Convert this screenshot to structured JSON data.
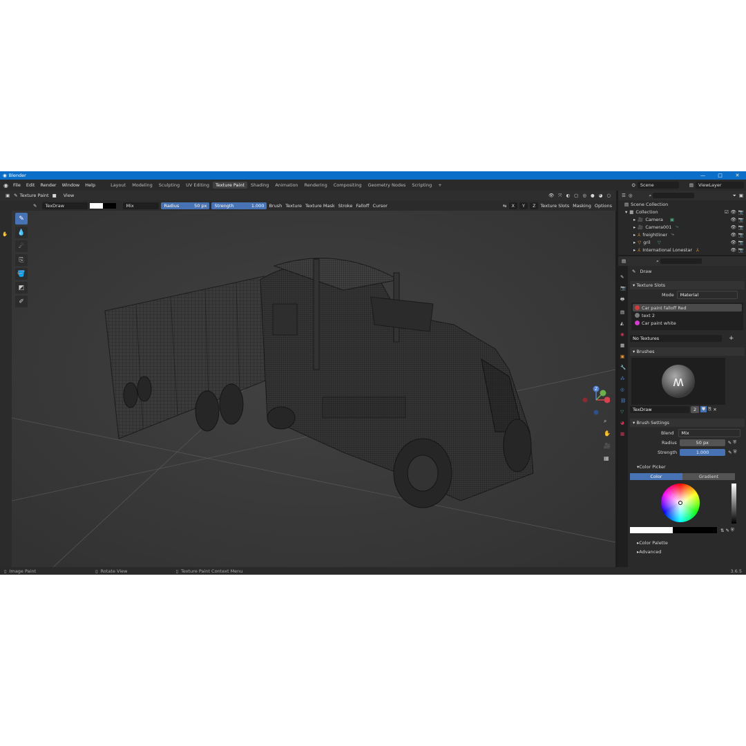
{
  "app": {
    "title": "Blender",
    "version": "3.6.5"
  },
  "window_controls": {
    "minimize": "—",
    "maximize": "□",
    "close": "✕"
  },
  "menu": [
    "File",
    "Edit",
    "Render",
    "Window",
    "Help"
  ],
  "workspaces": [
    {
      "label": "Layout"
    },
    {
      "label": "Modeling"
    },
    {
      "label": "Sculpting"
    },
    {
      "label": "UV Editing"
    },
    {
      "label": "Texture Paint",
      "active": true
    },
    {
      "label": "Shading"
    },
    {
      "label": "Animation"
    },
    {
      "label": "Rendering"
    },
    {
      "label": "Compositing"
    },
    {
      "label": "Geometry Nodes"
    },
    {
      "label": "Scripting"
    }
  ],
  "add_workspace": "+",
  "scene": {
    "name": "Scene",
    "view_layer": "ViewLayer"
  },
  "viewport_header": {
    "mode": "Texture Paint",
    "view": "View"
  },
  "toolbar": {
    "brush_name": "TexDraw",
    "blend": "Mix",
    "radius_label": "Radius",
    "radius_value": "50 px",
    "strength_label": "Strength",
    "strength_value": "1.000",
    "menus": [
      "Brush",
      "Texture",
      "Texture Mask",
      "Stroke",
      "Falloff",
      "Cursor"
    ],
    "xyz": [
      "X",
      "Y",
      "Z"
    ],
    "right_menus": [
      "Texture Slots",
      "Masking",
      "Options"
    ]
  },
  "colors": {
    "primary": "#ffffff",
    "secondary": "#000000",
    "accent": "#4772b3",
    "viewport_bg": "#3d3d3d"
  },
  "status_bar": {
    "items": [
      "Image Paint",
      "Rotate View",
      "Texture Paint Context Menu"
    ],
    "version": "3.6.5"
  },
  "outliner": {
    "header": "Scene Collection",
    "collection": "Collection",
    "items": [
      "Camera",
      "Camera001",
      "freightliner",
      "gril",
      "International Lonestar"
    ]
  },
  "properties": {
    "tool_name": "Draw",
    "texture_slots": {
      "section": "Texture Slots",
      "mode_label": "Mode",
      "mode_value": "Material",
      "slots": [
        {
          "name": "Car paint falloff Red",
          "color": "#d33a3a",
          "selected": true
        },
        {
          "name": "text 2",
          "color": "#7a7a7a"
        },
        {
          "name": "Car paint white",
          "color": "#d63ad0"
        }
      ],
      "no_textures": "No Textures",
      "add_icon": "+"
    },
    "brushes": {
      "section": "Brushes",
      "brush_name": "TexDraw",
      "user_count": "2"
    },
    "brush_settings": {
      "section": "Brush Settings",
      "blend_label": "Blend",
      "blend_value": "Mix",
      "radius_label": "Radius",
      "radius_value": "50 px",
      "strength_label": "Strength",
      "strength_value": "1.000"
    },
    "color_picker": {
      "section": "Color Picker",
      "tabs": [
        "Color",
        "Gradient"
      ],
      "active_tab": "Color"
    },
    "color_palette": "Color Palette",
    "advanced": "Advanced"
  }
}
